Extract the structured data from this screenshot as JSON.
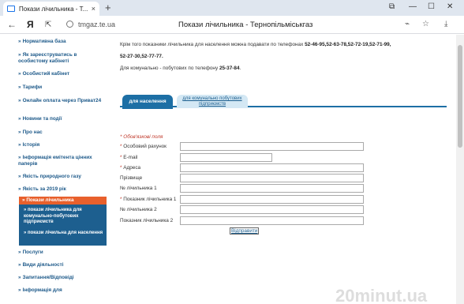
{
  "browser": {
    "tab_title": "Покази лічильника - Т...",
    "tab_close": "×",
    "new_tab": "+",
    "logo": "Я",
    "url": "tmgaz.te.ua",
    "page_title": "Покази лічильника - Тернопільміськгаз",
    "window_controls": [
      "⧉",
      "—",
      "☐",
      "✕"
    ],
    "nav_back": "←",
    "nav_forward": "→"
  },
  "sidebar": {
    "items": [
      {
        "label": "Нормативна база"
      },
      {
        "label": "Як зареєструватись в особистому кабінеті"
      },
      {
        "label": "Особистий кабінет"
      },
      {
        "label": "Тарифи"
      },
      {
        "label": "Онлайн оплата через Приват24"
      },
      {
        "label": "Новини та події"
      },
      {
        "label": "Про нас"
      },
      {
        "label": "Історія"
      },
      {
        "label": "Інформація емітента цінних паперів"
      },
      {
        "label": "Якість природного газу"
      },
      {
        "label": "Якість за 2019 рік"
      }
    ],
    "active": {
      "label": "Покази лічильника",
      "subitems": [
        {
          "label": "покази лічильника для комунально-побутових підприємств"
        },
        {
          "label": "покази лічильна для населення"
        }
      ]
    },
    "items_after": [
      {
        "label": "Послуги"
      },
      {
        "label": "Види діяльності"
      },
      {
        "label": "Запитання/Відповіді"
      },
      {
        "label": "Інформація для"
      }
    ]
  },
  "content": {
    "line1": "Крім того показники лічильника для населення  можна подавати по телефонах ",
    "line1_phones": "52-46-95,52-63-78,52-72-19,52-71-99,",
    "line2_phones": "52-27-30,52-77-77.",
    "line3": "Для комунально - побутових по телефону ",
    "line3_phone": "25-37-84",
    "line3_end": ".",
    "tabs": {
      "tab1": "для населення",
      "tab2": "для комунально побутових підприємств"
    },
    "required_note": "Обов'язкові поля",
    "fields": [
      {
        "label": "Особовий рахунок",
        "required": true,
        "value": ""
      },
      {
        "label": "E-mail",
        "required": true,
        "value": ""
      },
      {
        "label": "Адреса",
        "required": true,
        "value": ""
      },
      {
        "label": "Прізвище",
        "required": false,
        "value": ""
      },
      {
        "label": "№ лічильника 1",
        "required": false,
        "value": ""
      },
      {
        "label": "Показник лічильника 1",
        "required": true,
        "value": ""
      },
      {
        "label": "№ лічильника 2",
        "required": false,
        "value": ""
      },
      {
        "label": "Показник лічильника 2",
        "required": false,
        "value": ""
      }
    ],
    "submit": "Відправити"
  },
  "watermark": "20minut.ua",
  "colors": {
    "accent": "#1d6fa5",
    "active_menu": "#e8602c",
    "menu_link": "#1e5a8a",
    "required": "#c0392b"
  }
}
